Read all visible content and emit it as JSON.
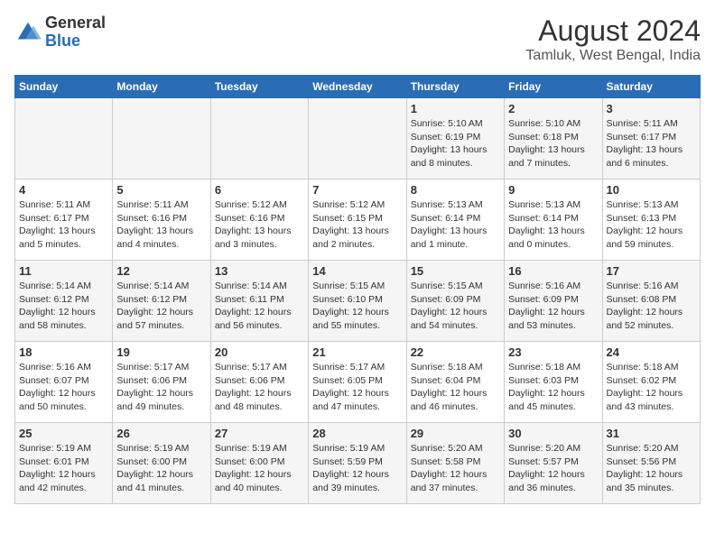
{
  "logo": {
    "line1": "General",
    "line2": "Blue"
  },
  "title": "August 2024",
  "subtitle": "Tamluk, West Bengal, India",
  "days_of_week": [
    "Sunday",
    "Monday",
    "Tuesday",
    "Wednesday",
    "Thursday",
    "Friday",
    "Saturday"
  ],
  "weeks": [
    [
      {
        "day": "",
        "info": ""
      },
      {
        "day": "",
        "info": ""
      },
      {
        "day": "",
        "info": ""
      },
      {
        "day": "",
        "info": ""
      },
      {
        "day": "1",
        "info": "Sunrise: 5:10 AM\nSunset: 6:19 PM\nDaylight: 13 hours\nand 8 minutes."
      },
      {
        "day": "2",
        "info": "Sunrise: 5:10 AM\nSunset: 6:18 PM\nDaylight: 13 hours\nand 7 minutes."
      },
      {
        "day": "3",
        "info": "Sunrise: 5:11 AM\nSunset: 6:17 PM\nDaylight: 13 hours\nand 6 minutes."
      }
    ],
    [
      {
        "day": "4",
        "info": "Sunrise: 5:11 AM\nSunset: 6:17 PM\nDaylight: 13 hours\nand 5 minutes."
      },
      {
        "day": "5",
        "info": "Sunrise: 5:11 AM\nSunset: 6:16 PM\nDaylight: 13 hours\nand 4 minutes."
      },
      {
        "day": "6",
        "info": "Sunrise: 5:12 AM\nSunset: 6:16 PM\nDaylight: 13 hours\nand 3 minutes."
      },
      {
        "day": "7",
        "info": "Sunrise: 5:12 AM\nSunset: 6:15 PM\nDaylight: 13 hours\nand 2 minutes."
      },
      {
        "day": "8",
        "info": "Sunrise: 5:13 AM\nSunset: 6:14 PM\nDaylight: 13 hours\nand 1 minute."
      },
      {
        "day": "9",
        "info": "Sunrise: 5:13 AM\nSunset: 6:14 PM\nDaylight: 13 hours\nand 0 minutes."
      },
      {
        "day": "10",
        "info": "Sunrise: 5:13 AM\nSunset: 6:13 PM\nDaylight: 12 hours\nand 59 minutes."
      }
    ],
    [
      {
        "day": "11",
        "info": "Sunrise: 5:14 AM\nSunset: 6:12 PM\nDaylight: 12 hours\nand 58 minutes."
      },
      {
        "day": "12",
        "info": "Sunrise: 5:14 AM\nSunset: 6:12 PM\nDaylight: 12 hours\nand 57 minutes."
      },
      {
        "day": "13",
        "info": "Sunrise: 5:14 AM\nSunset: 6:11 PM\nDaylight: 12 hours\nand 56 minutes."
      },
      {
        "day": "14",
        "info": "Sunrise: 5:15 AM\nSunset: 6:10 PM\nDaylight: 12 hours\nand 55 minutes."
      },
      {
        "day": "15",
        "info": "Sunrise: 5:15 AM\nSunset: 6:09 PM\nDaylight: 12 hours\nand 54 minutes."
      },
      {
        "day": "16",
        "info": "Sunrise: 5:16 AM\nSunset: 6:09 PM\nDaylight: 12 hours\nand 53 minutes."
      },
      {
        "day": "17",
        "info": "Sunrise: 5:16 AM\nSunset: 6:08 PM\nDaylight: 12 hours\nand 52 minutes."
      }
    ],
    [
      {
        "day": "18",
        "info": "Sunrise: 5:16 AM\nSunset: 6:07 PM\nDaylight: 12 hours\nand 50 minutes."
      },
      {
        "day": "19",
        "info": "Sunrise: 5:17 AM\nSunset: 6:06 PM\nDaylight: 12 hours\nand 49 minutes."
      },
      {
        "day": "20",
        "info": "Sunrise: 5:17 AM\nSunset: 6:06 PM\nDaylight: 12 hours\nand 48 minutes."
      },
      {
        "day": "21",
        "info": "Sunrise: 5:17 AM\nSunset: 6:05 PM\nDaylight: 12 hours\nand 47 minutes."
      },
      {
        "day": "22",
        "info": "Sunrise: 5:18 AM\nSunset: 6:04 PM\nDaylight: 12 hours\nand 46 minutes."
      },
      {
        "day": "23",
        "info": "Sunrise: 5:18 AM\nSunset: 6:03 PM\nDaylight: 12 hours\nand 45 minutes."
      },
      {
        "day": "24",
        "info": "Sunrise: 5:18 AM\nSunset: 6:02 PM\nDaylight: 12 hours\nand 43 minutes."
      }
    ],
    [
      {
        "day": "25",
        "info": "Sunrise: 5:19 AM\nSunset: 6:01 PM\nDaylight: 12 hours\nand 42 minutes."
      },
      {
        "day": "26",
        "info": "Sunrise: 5:19 AM\nSunset: 6:00 PM\nDaylight: 12 hours\nand 41 minutes."
      },
      {
        "day": "27",
        "info": "Sunrise: 5:19 AM\nSunset: 6:00 PM\nDaylight: 12 hours\nand 40 minutes."
      },
      {
        "day": "28",
        "info": "Sunrise: 5:19 AM\nSunset: 5:59 PM\nDaylight: 12 hours\nand 39 minutes."
      },
      {
        "day": "29",
        "info": "Sunrise: 5:20 AM\nSunset: 5:58 PM\nDaylight: 12 hours\nand 37 minutes."
      },
      {
        "day": "30",
        "info": "Sunrise: 5:20 AM\nSunset: 5:57 PM\nDaylight: 12 hours\nand 36 minutes."
      },
      {
        "day": "31",
        "info": "Sunrise: 5:20 AM\nSunset: 5:56 PM\nDaylight: 12 hours\nand 35 minutes."
      }
    ]
  ]
}
